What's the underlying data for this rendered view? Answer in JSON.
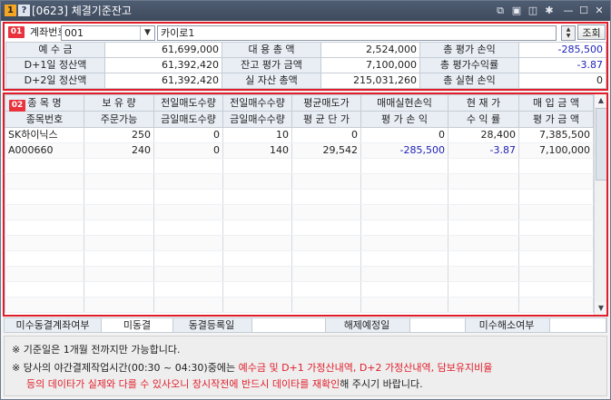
{
  "titlebar": {
    "badge_num": "1",
    "badge_help": "?",
    "title": "[0623] 체결기준잔고",
    "controls": [
      "restore-icon",
      "save-icon",
      "capture-icon",
      "settings-icon",
      "minimize-icon",
      "maximize-icon",
      "close-icon"
    ]
  },
  "section1": {
    "badge": "01",
    "account_label": "계좌번호",
    "account_value": "001",
    "account_name": "카이로1",
    "query_button": "조회",
    "rows": [
      [
        {
          "label": "예    수    금",
          "value": "61,699,000"
        },
        {
          "label": "대  용  총  액",
          "value": "2,524,000"
        },
        {
          "label": "총  평가  손익",
          "value": "-285,500",
          "negative": true
        }
      ],
      [
        {
          "label": "D+1일 정산액",
          "value": "61,392,420"
        },
        {
          "label": "잔고 평가 금액",
          "value": "7,100,000"
        },
        {
          "label": "총  평가수익률",
          "value": "-3.87",
          "negative": true
        }
      ],
      [
        {
          "label": "D+2일 정산액",
          "value": "61,392,420"
        },
        {
          "label": "실  자산  총액",
          "value": "215,031,260"
        },
        {
          "label": "총  실현  손익",
          "value": "0"
        }
      ]
    ]
  },
  "section2": {
    "badge": "02",
    "header_row1": [
      "종 목 명",
      "보 유 량",
      "전일매도수량",
      "전일매수수량",
      "평균매도가",
      "매매실현손익",
      "현 재 가",
      "매 입 금 액"
    ],
    "header_row2": [
      "종목번호",
      "주문가능",
      "금일매도수량",
      "금일매수수량",
      "평 균 단 가",
      "평 가 손 익",
      "수 익 률",
      "평 가 금 액"
    ],
    "rows": [
      {
        "cells": [
          "SK하이닉스",
          "250",
          "0",
          "10",
          "0",
          "0",
          "28,400",
          "7,385,500"
        ],
        "neg": []
      },
      {
        "cells": [
          "A000660",
          "240",
          "0",
          "140",
          "29,542",
          "-285,500",
          "-3.87",
          "7,100,000"
        ],
        "neg": [
          5,
          6
        ]
      }
    ]
  },
  "status": {
    "label1": "미수동결계좌여부",
    "value1": "미동결",
    "label2": "동결등록일",
    "value2": "",
    "label3": "해제예정일",
    "value3": "",
    "label4": "미수해소여부",
    "value4": ""
  },
  "notes": {
    "line1": "※ 기준일은 1개월 전까지만 가능합니다.",
    "line2_prefix": "※ 당사의 야간결제작업시간(00:30 ~ 04:30)중에는 ",
    "line2_red": "예수금 및 D+1 가정산내역, D+2 가정산내역, 담보유지비율",
    "line3_red": "등의 데이타가 실제와 다를 수 있사오니 장시작전에 반드시 데이타를 재확인",
    "line3_suffix": "해 주시기 바랍니다."
  }
}
